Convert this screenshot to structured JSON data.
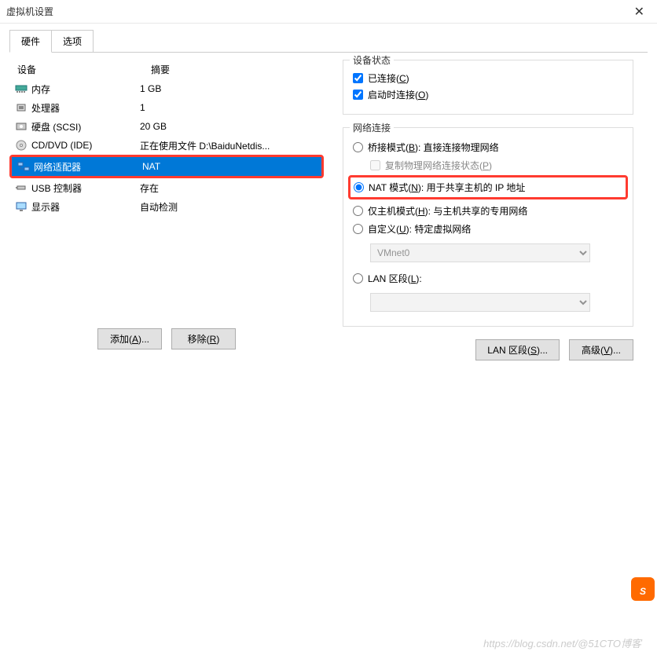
{
  "window": {
    "title": "虚拟机设置"
  },
  "tabs": {
    "hardware": "硬件",
    "options": "选项"
  },
  "headers": {
    "device": "设备",
    "summary": "摘要"
  },
  "devices": [
    {
      "name": "内存",
      "summary": "1 GB",
      "icon": "memory"
    },
    {
      "name": "处理器",
      "summary": "1",
      "icon": "cpu"
    },
    {
      "name": "硬盘 (SCSI)",
      "summary": "20 GB",
      "icon": "disk"
    },
    {
      "name": "CD/DVD (IDE)",
      "summary": "正在使用文件 D:\\BaiduNetdis...",
      "icon": "cd"
    },
    {
      "name": "网络适配器",
      "summary": "NAT",
      "icon": "net"
    },
    {
      "name": "USB 控制器",
      "summary": "存在",
      "icon": "usb"
    },
    {
      "name": "显示器",
      "summary": "自动检测",
      "icon": "display"
    }
  ],
  "buttons": {
    "add": "添加(A)...",
    "remove": "移除(R)",
    "lan": "LAN 区段(S)...",
    "adv": "高级(V)..."
  },
  "status": {
    "title": "设备状态",
    "connected": "已连接(C)",
    "connectOnStart": "启动时连接(O)"
  },
  "net": {
    "title": "网络连接",
    "bridged": "桥接模式(B): 直接连接物理网络",
    "replicate": "复制物理网络连接状态(P)",
    "nat": "NAT 模式(N): 用于共享主机的 IP 地址",
    "hostonly": "仅主机模式(H): 与主机共享的专用网络",
    "custom": "自定义(U): 特定虚拟网络",
    "customSelect": "VMnet0",
    "lanseg": "LAN 区段(L):"
  },
  "watermark": "https://blog.csdn.net/@51CTO博客"
}
